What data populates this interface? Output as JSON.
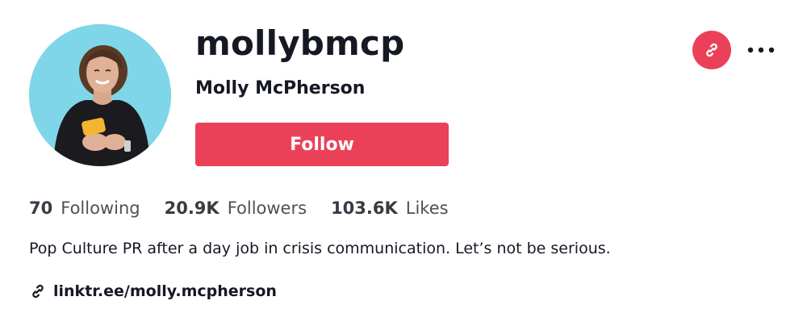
{
  "profile": {
    "username": "mollybmcp",
    "display_name": "Molly McPherson",
    "follow_label": "Follow",
    "bio": "Pop Culture PR after a day job in crisis communication. Let’s not be serious.",
    "link": "linktr.ee/molly.mcpherson"
  },
  "stats": [
    {
      "count": "70",
      "label": "Following"
    },
    {
      "count": "20.9K",
      "label": "Followers"
    },
    {
      "count": "103.6K",
      "label": "Likes"
    }
  ],
  "icons": {
    "share": "link-icon",
    "more": "ellipsis-icon",
    "bio_link": "link-icon"
  },
  "colors": {
    "accent": "#ea4159",
    "text": "#161823",
    "avatar_bg": "#7fd6e8"
  }
}
